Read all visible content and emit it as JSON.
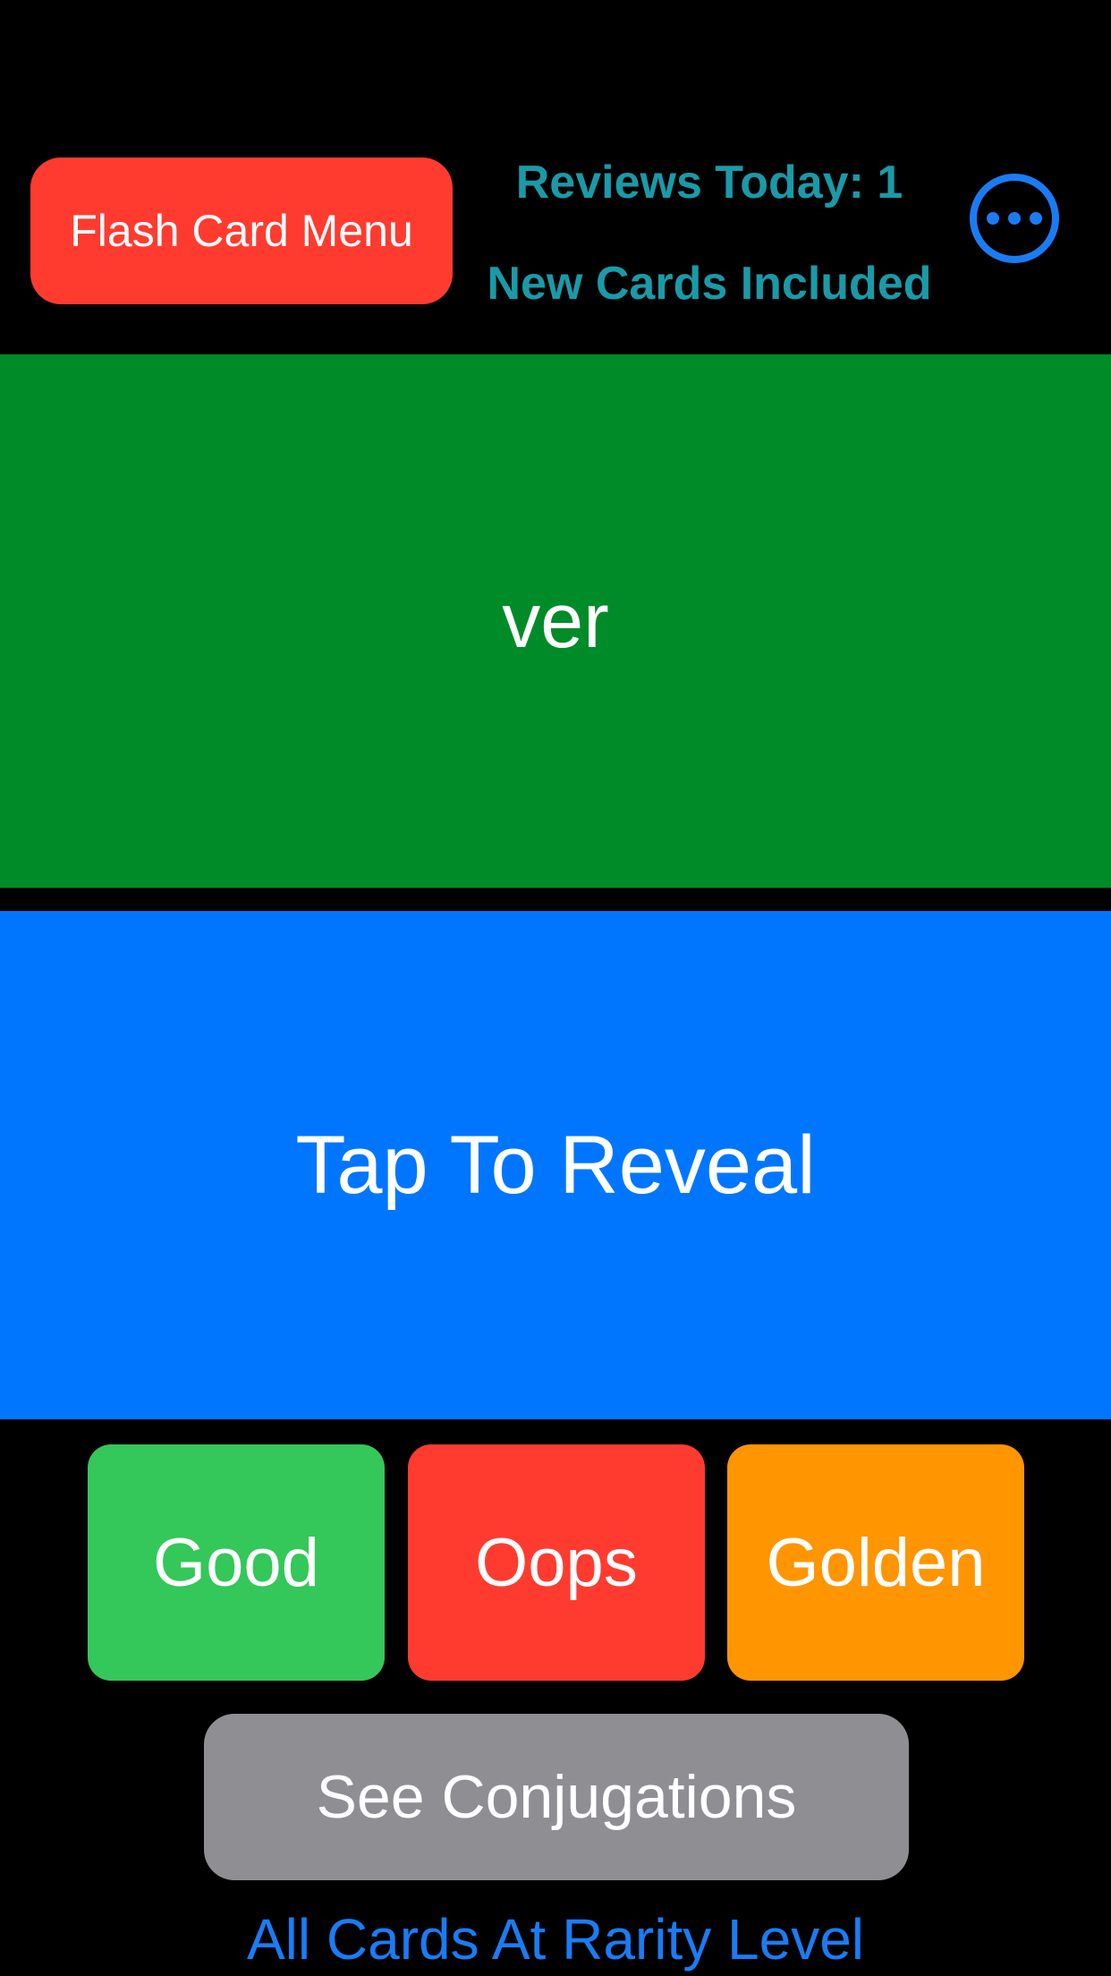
{
  "header": {
    "menu_button_label": "Flash Card Menu",
    "reviews_today": "Reviews Today: 1",
    "new_cards_status": "New Cards Included",
    "more_icon": "ellipsis-circle-icon"
  },
  "card": {
    "front_word": "ver",
    "reveal_label": "Tap To Reveal"
  },
  "grades": {
    "good_label": "Good",
    "oops_label": "Oops",
    "golden_label": "Golden"
  },
  "actions": {
    "conjugations_label": "See Conjugations",
    "rarity_link": "All Cards At Rarity Level"
  },
  "colors": {
    "menu_red": "#ff3b30",
    "info_teal": "#1a9aa8",
    "accent_blue": "#1a7cf5",
    "card_green": "#008b29",
    "reveal_blue": "#0076ff",
    "good_green": "#34c759",
    "golden_orange": "#ff9500",
    "conj_gray": "#8e8e93"
  }
}
